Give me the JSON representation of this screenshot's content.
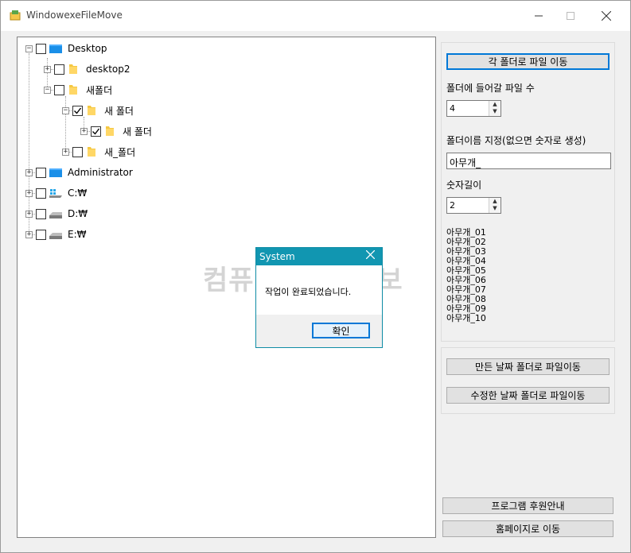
{
  "window": {
    "title": "WindowexeFileMove"
  },
  "tree": {
    "nodes": [
      {
        "label": "Desktop",
        "checked": false,
        "icon": "desktop-icon"
      },
      {
        "label": "desktop2",
        "checked": false,
        "icon": "folder-icon"
      },
      {
        "label": "새폴더",
        "checked": false,
        "icon": "folder-icon"
      },
      {
        "label": "새 폴더",
        "checked": true,
        "icon": "folder-icon"
      },
      {
        "label": "새 폴더",
        "checked": true,
        "icon": "folder-icon"
      },
      {
        "label": "새_폴더",
        "checked": false,
        "icon": "folder-icon"
      },
      {
        "label": "Administrator",
        "checked": false,
        "icon": "monitor-icon"
      },
      {
        "label": "C:₩",
        "checked": false,
        "icon": "windows-drive-icon"
      },
      {
        "label": "D:₩",
        "checked": false,
        "icon": "drive-icon"
      },
      {
        "label": "E:₩",
        "checked": false,
        "icon": "drive-icon"
      }
    ]
  },
  "panel": {
    "move_each_button": "각 폴더로 파일 이동",
    "files_per_folder_label": "폴더에 들어갈 파일 수",
    "files_per_folder_value": "4",
    "folder_name_label": "폴더이름 지정(없으면 숫자로 생성)",
    "folder_name_value": "아무개_",
    "digit_length_label": "숫자길이",
    "digit_length_value": "2",
    "preview": [
      "아무개_01",
      "아무개_02",
      "아무개_03",
      "아무개_04",
      "아무개_05",
      "아무개_06",
      "아무개_07",
      "아무개_08",
      "아무개_09",
      "아무개_10"
    ],
    "created_date_button": "만든 날짜 폴더로 파일이동",
    "modified_date_button": "수정한 날짜 폴더로 파일이동",
    "sponsor_button": "프로그램 후원안내",
    "homepage_button": "홈페이지로 이동"
  },
  "watermark": "컴퓨터 관련 정보",
  "dialog": {
    "title": "System",
    "message": "작업이 완료되었습니다.",
    "ok": "확인"
  },
  "colors": {
    "dialog_title": "#1196b1",
    "default_button_border": "#0078d7",
    "folder": "#f5c842"
  }
}
